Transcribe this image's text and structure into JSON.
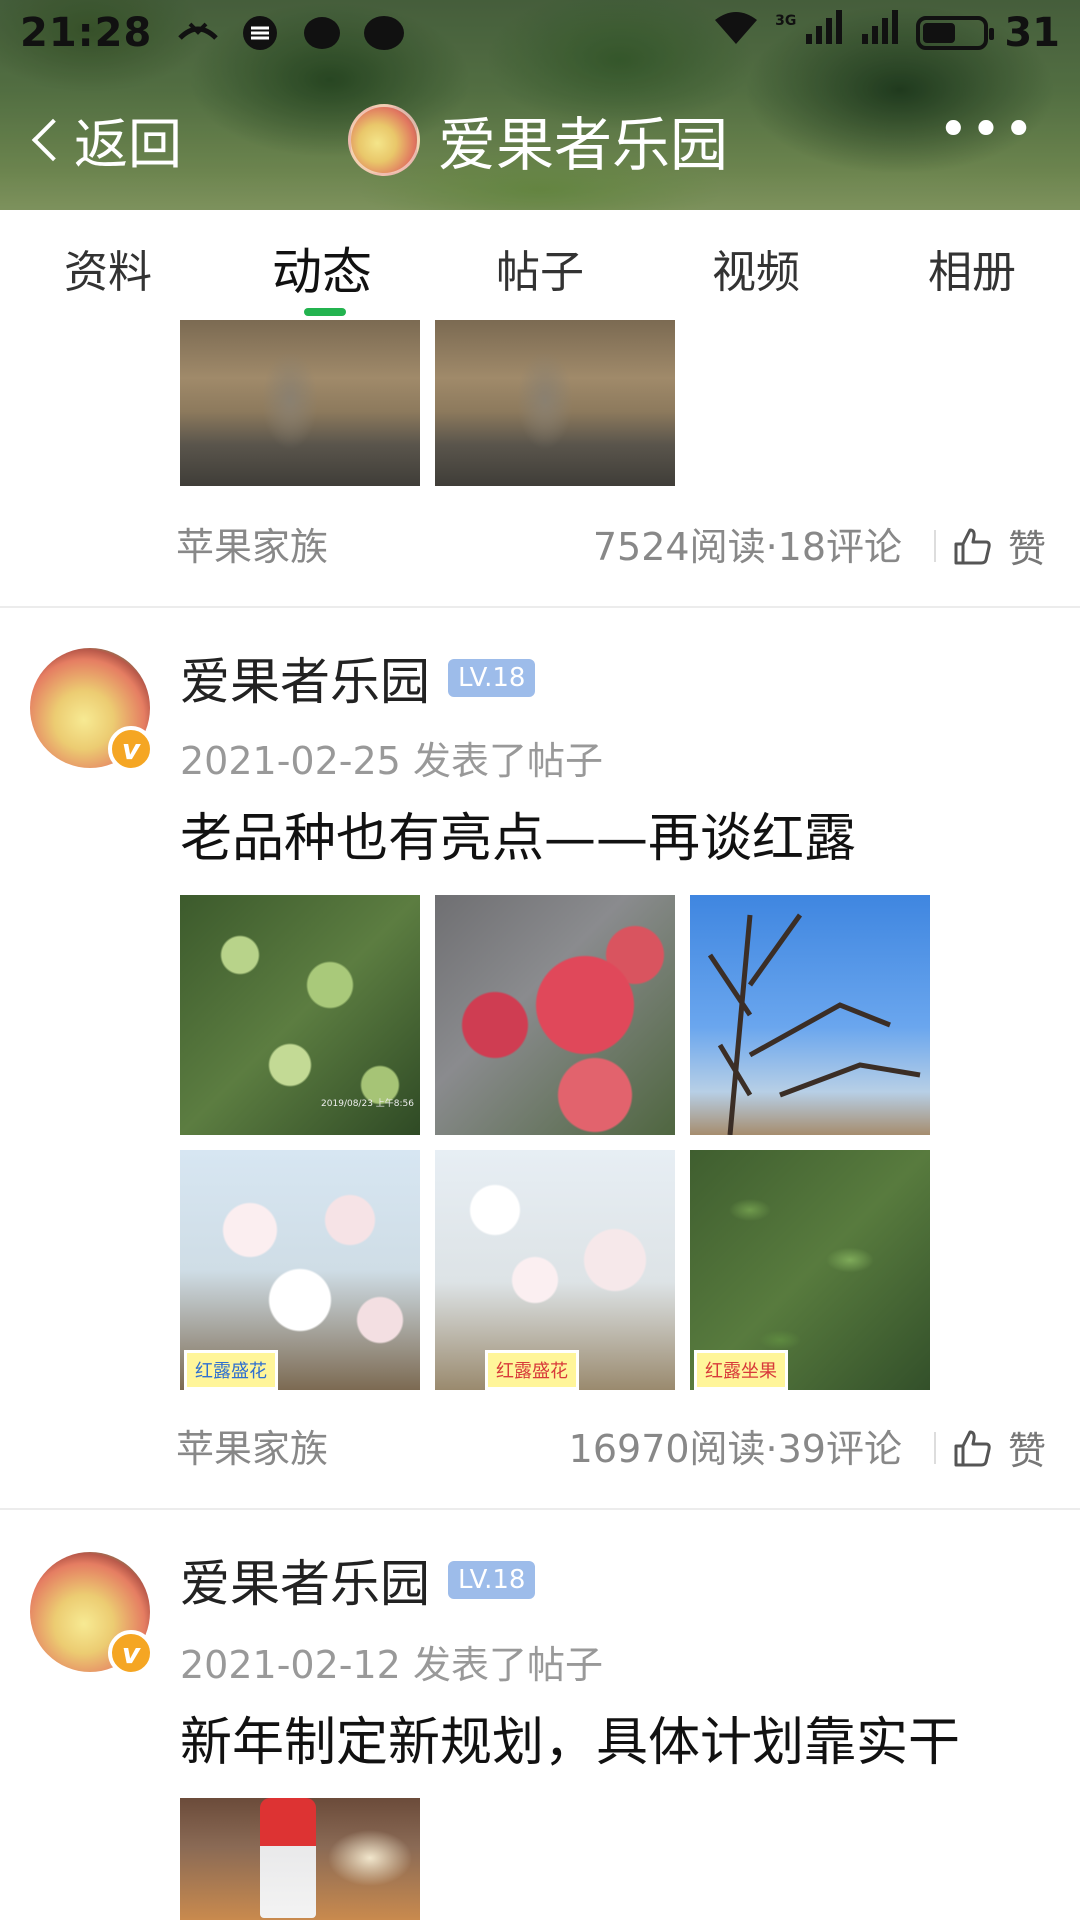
{
  "status_bar": {
    "time": "21:28",
    "network_label": "3G",
    "battery_level": "31",
    "battery_fraction": 0.55
  },
  "header": {
    "back_label": "返回",
    "title": "爱果者乐园",
    "more_label": "•••"
  },
  "tabs": [
    {
      "label": "资料",
      "active": false
    },
    {
      "label": "动态",
      "active": true
    },
    {
      "label": "帖子",
      "active": false
    },
    {
      "label": "视频",
      "active": false
    },
    {
      "label": "相册",
      "active": false
    }
  ],
  "colors": {
    "tab_indicator": "#23b34f",
    "level_badge": "#9dbcea",
    "verified_badge": "#f5a623"
  },
  "feed": {
    "top_post": {
      "source": "苹果家族",
      "stats": "7524阅读·18评论",
      "like_label": "赞"
    },
    "posts": [
      {
        "author": "爱果者乐园",
        "level": "LV.18",
        "date": "2021-02-25",
        "action": "发表了帖子",
        "title": "老品种也有亮点——再谈红露",
        "image_labels": [
          "红露盛花",
          "红露盛花",
          "红露坐果"
        ],
        "source": "苹果家族",
        "stats": "16970阅读·39评论",
        "like_label": "赞"
      },
      {
        "author": "爱果者乐园",
        "level": "LV.18",
        "date": "2021-02-12",
        "action": "发表了帖子",
        "title": "新年制定新规划，具体计划靠实干"
      }
    ]
  }
}
